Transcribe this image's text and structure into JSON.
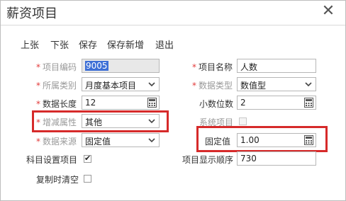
{
  "dialog": {
    "title": "薪资项目",
    "close_icon": "close-icon"
  },
  "toolbar": {
    "items": [
      "上张",
      "下张",
      "保存",
      "保存新增",
      "退出"
    ]
  },
  "form": {
    "item_code": {
      "label": "项目编码",
      "value": "9005"
    },
    "category": {
      "label": "所属类别",
      "value": "月度基本项目"
    },
    "data_length": {
      "label": "数据长度",
      "value": "12"
    },
    "inc_dec_attr": {
      "label": "增减属性",
      "value": "其他"
    },
    "data_source": {
      "label": "数据来源",
      "value": "固定值"
    },
    "subject_setting": {
      "label": "科目设置项目",
      "checked": true
    },
    "clear_on_copy": {
      "label": "复制时清空",
      "checked": false
    },
    "item_name": {
      "label": "项目名称",
      "value": "人数"
    },
    "data_type": {
      "label": "数据类型",
      "value": "数值型"
    },
    "decimals": {
      "label": "小数位数",
      "value": "2"
    },
    "system_item": {
      "label": "系统项目",
      "checked": false
    },
    "fixed_value": {
      "label": "固定值",
      "value": "1.00"
    },
    "display_order": {
      "label": "项目显示顺序",
      "value": "730"
    }
  },
  "colors": {
    "required": "#e23a3a",
    "highlight": "#d62a2a",
    "selection": "#3d6fd6"
  }
}
